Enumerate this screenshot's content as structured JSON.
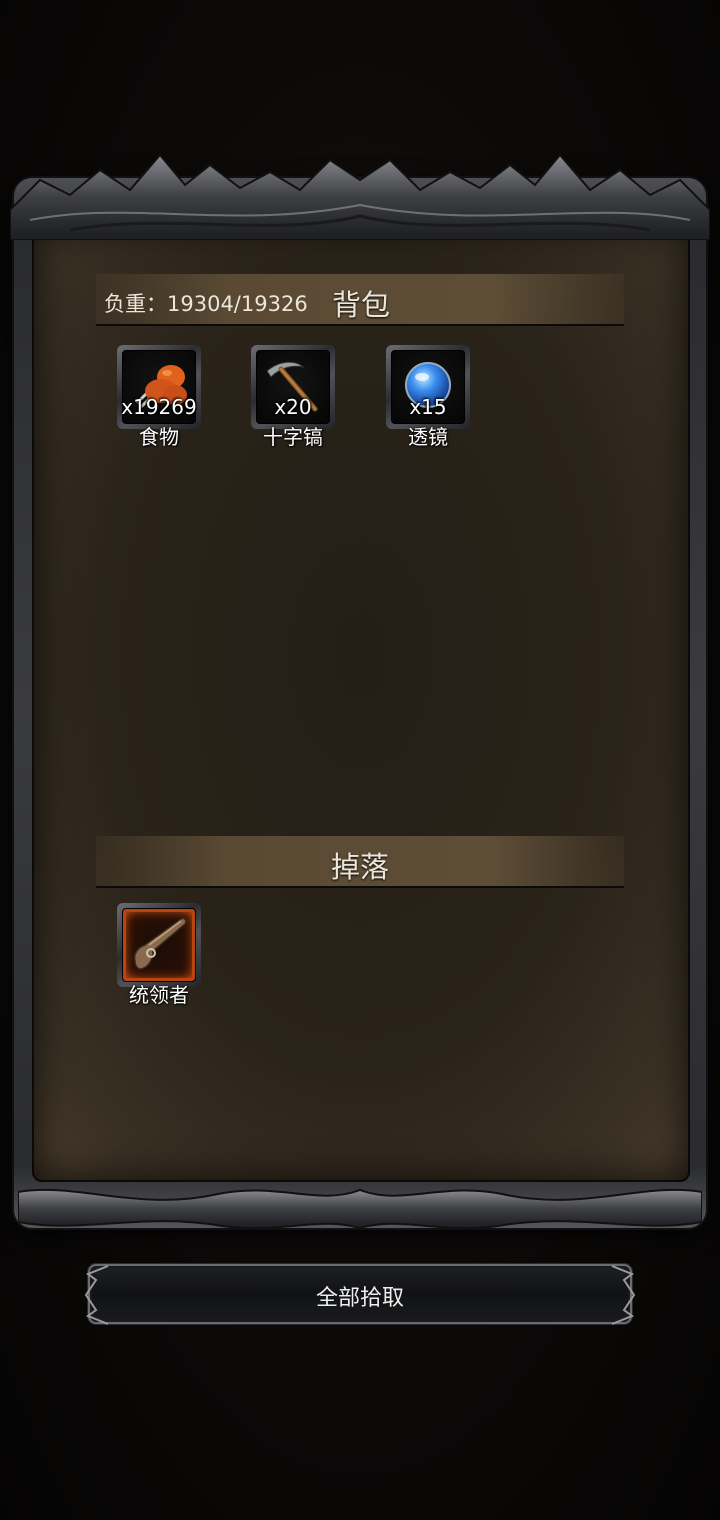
{
  "backpack": {
    "load_label": "负重：19304/19326",
    "title": "背包",
    "items": [
      {
        "icon": "meat-icon",
        "count": "x19269",
        "name": "食物"
      },
      {
        "icon": "pickaxe-icon",
        "count": "x20",
        "name": "十字镐"
      },
      {
        "icon": "lens-icon",
        "count": "x15",
        "name": "透镜"
      }
    ]
  },
  "drops": {
    "title": "掉落",
    "items": [
      {
        "icon": "flintlock-pistol-icon",
        "name": "统领者",
        "rarity_color": "#b9440f"
      }
    ]
  },
  "actions": {
    "pickup_all_label": "全部拾取"
  }
}
